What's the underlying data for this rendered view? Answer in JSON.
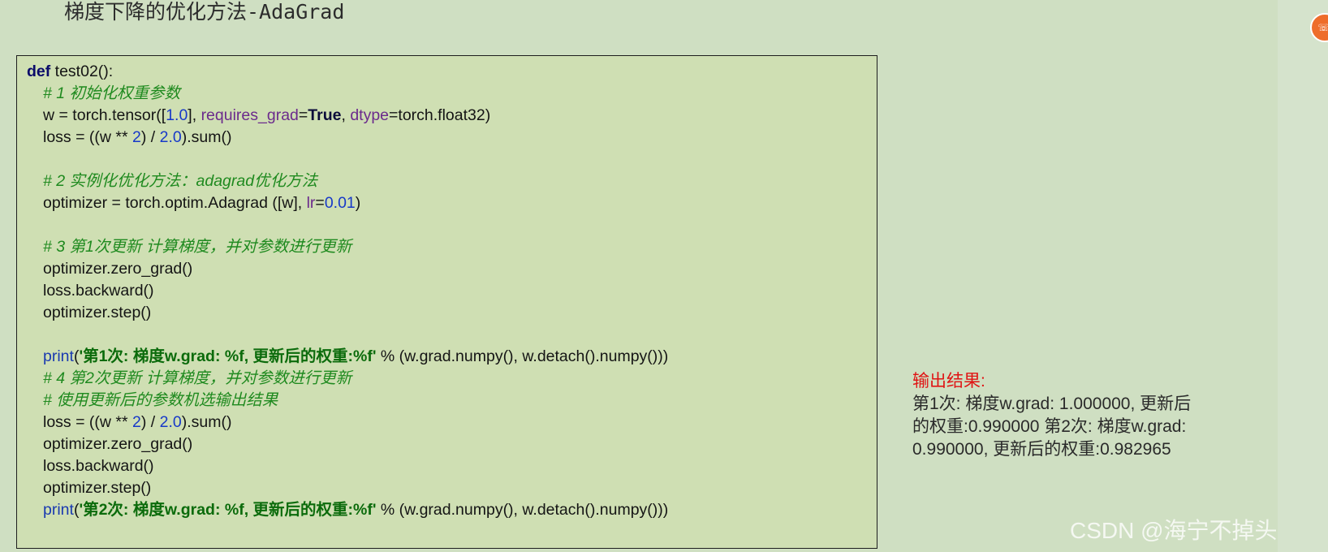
{
  "slide": {
    "title": "梯度下降的优化方法-AdaGrad"
  },
  "code": {
    "l1_def": "def",
    "l1_rest": " test02():",
    "l2_comment": "# 1 初始化权重参数",
    "l3_a": "w = torch.tensor([",
    "l3_num": "1.0",
    "l3_b": "], ",
    "l3_arg1": "requires_grad",
    "l3_c": "=",
    "l3_true": "True",
    "l3_d": ", ",
    "l3_arg2": "dtype",
    "l3_e": "=torch.float32)",
    "l4_a": "loss = ((w ** ",
    "l4_n1": "2",
    "l4_b": ") / ",
    "l4_n2": "2.0",
    "l4_c": ").sum()",
    "l6_comment": "# 2 实例化优化方法：adagrad优化方法",
    "l7_a": "optimizer = torch.optim.Adagrad ([w], ",
    "l7_arg": "lr",
    "l7_b": "=",
    "l7_num": "0.01",
    "l7_c": ")",
    "l9_comment": "# 3 第1次更新 计算梯度，并对参数进行更新",
    "l10": "optimizer.zero_grad()",
    "l11": "loss.backward()",
    "l12": "optimizer.step()",
    "l14_fn": "print",
    "l14_a": "(",
    "l14_str": "'第1次: 梯度w.grad: %f, 更新后的权重:%f'",
    "l14_b": " % (w.grad.numpy(), w.detach().numpy()))",
    "l15_comment": "# 4 第2次更新 计算梯度，并对参数进行更新",
    "l16_comment": "# 使用更新后的参数机选输出结果",
    "l17_a": "loss = ((w ** ",
    "l17_n1": "2",
    "l17_b": ") / ",
    "l17_n2": "2.0",
    "l17_c": ").sum()",
    "l18": "optimizer.zero_grad()",
    "l19": "loss.backward()",
    "l20": "optimizer.step()",
    "l21_fn": "print",
    "l21_a": "(",
    "l21_str": "'第2次: 梯度w.grad: %f, 更新后的权重:%f'",
    "l21_b": " % (w.grad.numpy(), w.detach().numpy()))"
  },
  "output": {
    "label": "输出结果:",
    "text": "第1次: 梯度w.grad: 1.000000, 更新后的权重:0.990000 第2次: 梯度w.grad: 0.990000, 更新后的权重:0.982965"
  },
  "watermark": "CSDN @海宁不掉头发",
  "float_button": {
    "icon": "chat-icon",
    "glyph": "☏"
  },
  "colors": {
    "background": "#cfdfc2",
    "code_background": "#cfdfb3",
    "comment": "#1f8a1f",
    "number": "#1739c9",
    "keyword": "#0b0b6a",
    "output_label": "#e01414",
    "float_button": "#ee6d2b"
  }
}
